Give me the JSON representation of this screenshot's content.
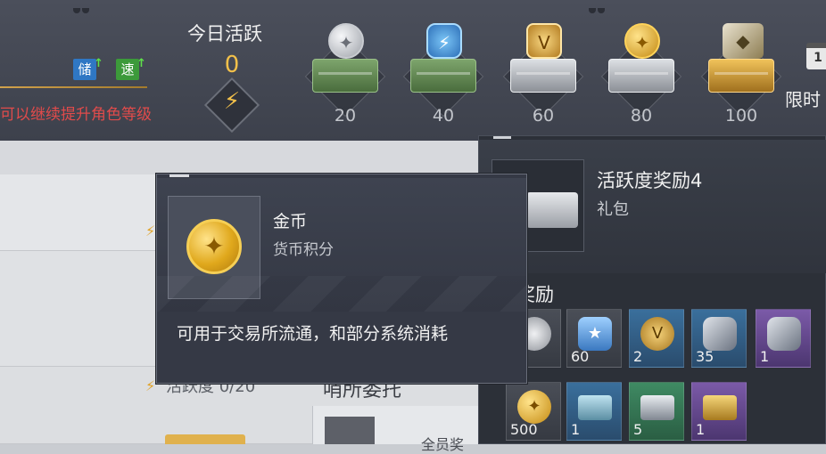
{
  "top": {
    "boost_store": "储",
    "boost_speed": "速",
    "hint": "可以继续提升角色等级",
    "activity_title": "今日活跃",
    "activity_count": "0",
    "milestones": [
      {
        "value": "20",
        "chest": "green",
        "medal": "silvercoin",
        "glyph": "✦"
      },
      {
        "value": "40",
        "chest": "green",
        "medal": "blueshield",
        "glyph": "⚡"
      },
      {
        "value": "60",
        "chest": "silver",
        "medal": "goldvee",
        "glyph": "V"
      },
      {
        "value": "80",
        "chest": "silver",
        "medal": "goldcoin",
        "glyph": "✦"
      },
      {
        "value": "100",
        "chest": "gold",
        "medal": "crystal",
        "glyph": "◆"
      }
    ],
    "limited_label": "限时",
    "calendar_day": "1"
  },
  "left": {
    "activity_label": "活跃度   0/20",
    "task_label": "哨所委托",
    "cut_text": "全员奖"
  },
  "reward_panel": {
    "title": "活跃度奖励4",
    "subtitle": "礼包",
    "section": "奖励",
    "items": [
      {
        "qty": "0",
        "style": "grey",
        "icon": "silver",
        "glyph": ""
      },
      {
        "qty": "60",
        "style": "grey",
        "icon": "shield",
        "glyph": "★"
      },
      {
        "qty": "2",
        "style": "blue",
        "icon": "medal",
        "glyph": "V"
      },
      {
        "qty": "35",
        "style": "blue",
        "icon": "plate",
        "glyph": ""
      },
      {
        "qty": "1",
        "style": "purple",
        "icon": "plate",
        "glyph": ""
      },
      {
        "qty": "500",
        "style": "grey",
        "icon": "coin",
        "glyph": "✦"
      },
      {
        "qty": "1",
        "style": "blue",
        "icon": "chestb",
        "glyph": ""
      },
      {
        "qty": "5",
        "style": "green",
        "icon": "chestg",
        "glyph": ""
      },
      {
        "qty": "1",
        "style": "purple",
        "icon": "chesty",
        "glyph": ""
      }
    ]
  },
  "tooltip": {
    "name": "金币",
    "type": "货币积分",
    "description": "可用于交易所流通，和部分系统消耗"
  },
  "colors": {
    "accent_gold": "#f2c04a",
    "hint_red": "#e14b4b"
  }
}
